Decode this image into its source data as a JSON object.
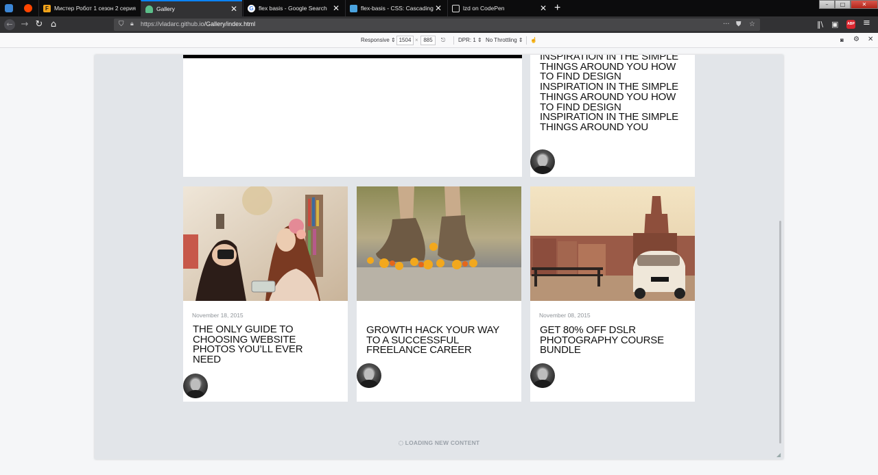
{
  "browser": {
    "tabs": [
      {
        "title": "Мистер Робот 1 сезон 2 серия"
      },
      {
        "title": "Gallery"
      },
      {
        "title": "flex basis - Google Search"
      },
      {
        "title": "flex-basis - CSS: Cascading Style Sheets"
      },
      {
        "title": "lzd on CodePen"
      }
    ],
    "close_glyph": "✕",
    "new_tab_glyph": "+",
    "url_domain": "https://vladarc.github.io",
    "url_path": "/Gallery/index.html"
  },
  "rdm_toolbar": {
    "device": "Responsive",
    "width": "1504",
    "times": "×",
    "height": "885",
    "dpr": "DPR: 1",
    "throttling": "No Throttling"
  },
  "page": {
    "top_right_headline": "Inspiration in the simple things around you How to find design inspiration in the simple things around you How to find design inspiration in the simple things around you",
    "cards": [
      {
        "date": "November 18, 2015",
        "headline": "The only guide to choosing website photos you’ll ever need"
      },
      {
        "date": "",
        "headline": "Growth hack your way to a successful freelance career"
      },
      {
        "date": "November 08, 2015",
        "headline": "Get 80% off DSLR photography course bundle"
      }
    ],
    "loading": "LOADING NEW CONTENT"
  }
}
